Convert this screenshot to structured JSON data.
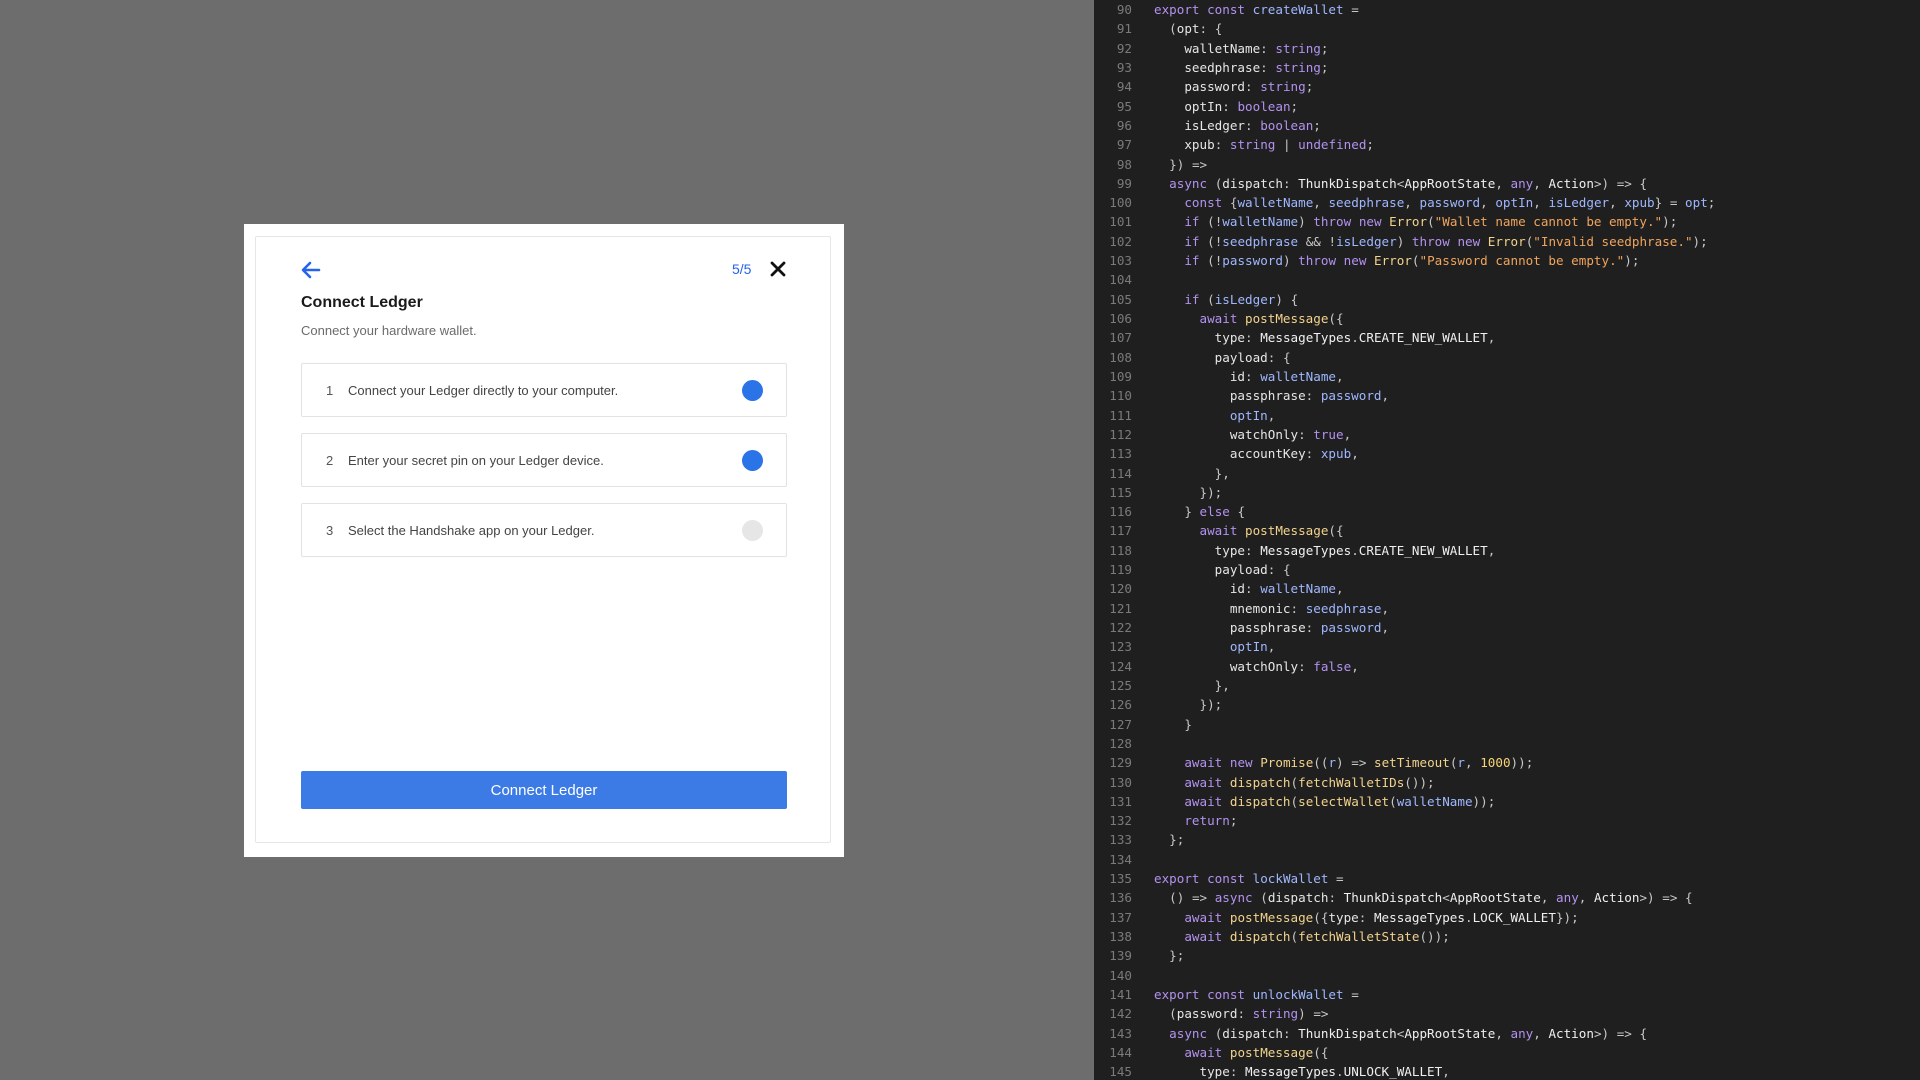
{
  "dialog": {
    "step_counter": "5/5",
    "title": "Connect Ledger",
    "subtitle": "Connect your hardware wallet.",
    "steps": [
      {
        "number": "1",
        "text": "Connect your Ledger directly to your computer.",
        "status": "done"
      },
      {
        "number": "2",
        "text": "Enter your secret pin on your Ledger device.",
        "status": "done"
      },
      {
        "number": "3",
        "text": "Select the Handshake app on your Ledger.",
        "status": "pending"
      }
    ],
    "primary_button": "Connect Ledger",
    "icons": {
      "back": "arrow-left-icon",
      "close": "close-icon"
    },
    "colors": {
      "accent": "#2563eb",
      "dot_done": "#2b74e8",
      "dot_pending": "#e6e6e6"
    }
  },
  "code": {
    "lines": [
      {
        "n": "90",
        "code": "export const createWallet ="
      },
      {
        "n": "91",
        "code": "  (opt: {"
      },
      {
        "n": "92",
        "code": "    walletName: string;"
      },
      {
        "n": "93",
        "code": "    seedphrase: string;"
      },
      {
        "n": "94",
        "code": "    password: string;"
      },
      {
        "n": "95",
        "code": "    optIn: boolean;"
      },
      {
        "n": "96",
        "code": "    isLedger: boolean;"
      },
      {
        "n": "97",
        "code": "    xpub: string | undefined;"
      },
      {
        "n": "98",
        "code": "  }) =>"
      },
      {
        "n": "99",
        "code": "  async (dispatch: ThunkDispatch<AppRootState, any, Action>) => {"
      },
      {
        "n": "100",
        "code": "    const {walletName, seedphrase, password, optIn, isLedger, xpub} = opt;"
      },
      {
        "n": "101",
        "code": "    if (!walletName) throw new Error(\"Wallet name cannot be empty.\");"
      },
      {
        "n": "102",
        "code": "    if (!seedphrase && !isLedger) throw new Error(\"Invalid seedphrase.\");"
      },
      {
        "n": "103",
        "code": "    if (!password) throw new Error(\"Password cannot be empty.\");"
      },
      {
        "n": "104",
        "code": ""
      },
      {
        "n": "105",
        "code": "    if (isLedger) {"
      },
      {
        "n": "106",
        "code": "      await postMessage({"
      },
      {
        "n": "107",
        "code": "        type: MessageTypes.CREATE_NEW_WALLET,"
      },
      {
        "n": "108",
        "code": "        payload: {"
      },
      {
        "n": "109",
        "code": "          id: walletName,"
      },
      {
        "n": "110",
        "code": "          passphrase: password,"
      },
      {
        "n": "111",
        "code": "          optIn,"
      },
      {
        "n": "112",
        "code": "          watchOnly: true,"
      },
      {
        "n": "113",
        "code": "          accountKey: xpub,"
      },
      {
        "n": "114",
        "code": "        },"
      },
      {
        "n": "115",
        "code": "      });"
      },
      {
        "n": "116",
        "code": "    } else {"
      },
      {
        "n": "117",
        "code": "      await postMessage({"
      },
      {
        "n": "118",
        "code": "        type: MessageTypes.CREATE_NEW_WALLET,"
      },
      {
        "n": "119",
        "code": "        payload: {"
      },
      {
        "n": "120",
        "code": "          id: walletName,"
      },
      {
        "n": "121",
        "code": "          mnemonic: seedphrase,"
      },
      {
        "n": "122",
        "code": "          passphrase: password,"
      },
      {
        "n": "123",
        "code": "          optIn,"
      },
      {
        "n": "124",
        "code": "          watchOnly: false,"
      },
      {
        "n": "125",
        "code": "        },"
      },
      {
        "n": "126",
        "code": "      });"
      },
      {
        "n": "127",
        "code": "    }"
      },
      {
        "n": "128",
        "code": ""
      },
      {
        "n": "129",
        "code": "    await new Promise((r) => setTimeout(r, 1000));"
      },
      {
        "n": "130",
        "code": "    await dispatch(fetchWalletIDs());"
      },
      {
        "n": "131",
        "code": "    await dispatch(selectWallet(walletName));"
      },
      {
        "n": "132",
        "code": "    return;"
      },
      {
        "n": "133",
        "code": "  };"
      },
      {
        "n": "134",
        "code": ""
      },
      {
        "n": "135",
        "code": "export const lockWallet ="
      },
      {
        "n": "136",
        "code": "  () => async (dispatch: ThunkDispatch<AppRootState, any, Action>) => {"
      },
      {
        "n": "137",
        "code": "    await postMessage({type: MessageTypes.LOCK_WALLET});"
      },
      {
        "n": "138",
        "code": "    await dispatch(fetchWalletState());"
      },
      {
        "n": "139",
        "code": "  };"
      },
      {
        "n": "140",
        "code": ""
      },
      {
        "n": "141",
        "code": "export const unlockWallet ="
      },
      {
        "n": "142",
        "code": "  (password: string) =>"
      },
      {
        "n": "143",
        "code": "  async (dispatch: ThunkDispatch<AppRootState, any, Action>) => {"
      },
      {
        "n": "144",
        "code": "    await postMessage({"
      },
      {
        "n": "145",
        "code": "      type: MessageTypes.UNLOCK_WALLET,"
      }
    ]
  }
}
